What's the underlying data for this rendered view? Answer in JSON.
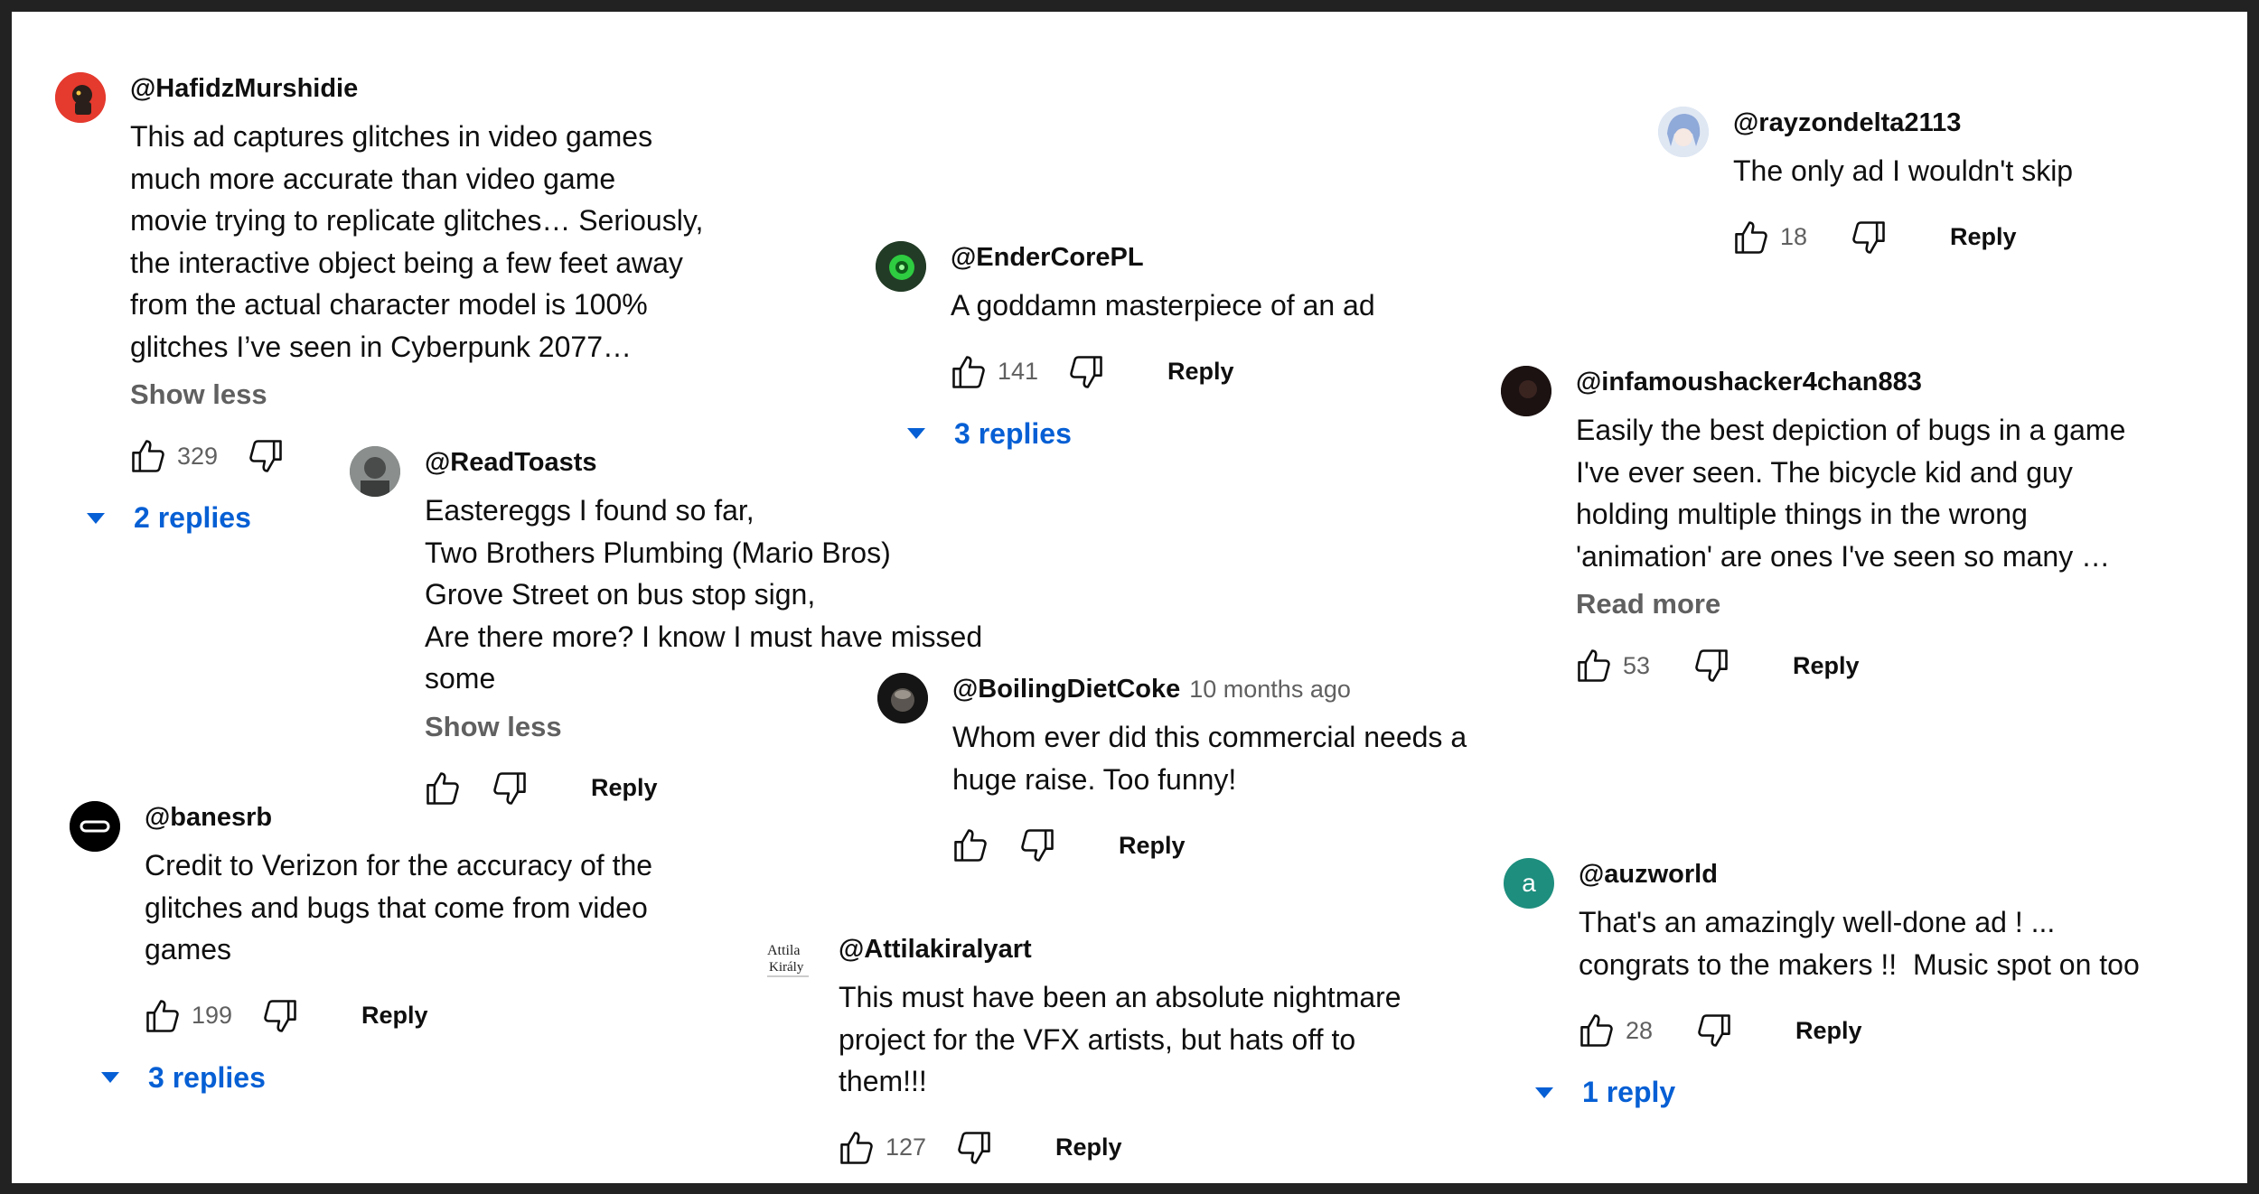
{
  "comments": {
    "c1": {
      "handle": "@HafidzMurshidie",
      "lines": [
        "This ad captures glitches in video games",
        "much more accurate than video game",
        "movie trying to replicate glitches… Seriously,",
        "the interactive object being a few feet away",
        "from the actual character model is 100%",
        "glitches I’ve seen in Cyberpunk 2077…"
      ],
      "more": "Show less",
      "likes": "329",
      "replies": "2 replies"
    },
    "c2": {
      "handle": "@ReadToasts",
      "lines": [
        "Eastereggs I found so far,",
        "Two Brothers Plumbing (Mario Bros)",
        "Grove Street on bus stop sign,",
        "Are there more? I know I must have missed",
        "some"
      ],
      "more": "Show less",
      "reply": "Reply"
    },
    "c3": {
      "handle": "@banesrb",
      "lines": [
        "Credit to Verizon for the accuracy of the",
        "glitches and bugs that come from video",
        "games"
      ],
      "likes": "199",
      "reply": "Reply",
      "replies": "3 replies"
    },
    "c4": {
      "handle": "@EnderCorePL",
      "lines": [
        "A goddamn masterpiece of an ad"
      ],
      "likes": "141",
      "reply": "Reply",
      "replies": "3 replies"
    },
    "c5": {
      "handle": "@BoilingDietCoke",
      "time": "10 months ago",
      "lines": [
        "Whom ever did this commercial needs a",
        "huge raise. Too funny!"
      ],
      "reply": "Reply"
    },
    "c6": {
      "handle": "@Attilakiralyart",
      "lines": [
        "This must have been an absolute nightmare",
        "project for the VFX artists, but hats off to",
        "them!!!"
      ],
      "likes": "127",
      "reply": "Reply",
      "avatar_text": "Attila Kiraly"
    },
    "c7": {
      "handle": "@rayzondelta2113",
      "lines": [
        "The only ad I wouldn't skip"
      ],
      "likes": "18",
      "reply": "Reply"
    },
    "c8": {
      "handle": "@infamoushacker4chan883",
      "lines": [
        "Easily the best depiction of bugs in a game",
        "I've ever seen. The bicycle kid and guy",
        "holding multiple things in the wrong",
        "'animation' are ones I've seen so many …"
      ],
      "more": "Read more",
      "likes": "53",
      "reply": "Reply"
    },
    "c9": {
      "handle": "@auzworld",
      "avatar_letter": "a",
      "lines": [
        "That's an amazingly well-done ad ! ...",
        "congrats to the makers !!  Music spot on too"
      ],
      "likes": "28",
      "reply": "Reply",
      "replies": "1 reply"
    }
  },
  "colors": {
    "link": "#065fd4",
    "text": "#0f0f0f",
    "secondary": "#606060",
    "auz_avatar": "#1e8e7e"
  },
  "icons": [
    "thumbs-up-icon",
    "thumbs-down-icon",
    "caret-down-icon"
  ]
}
